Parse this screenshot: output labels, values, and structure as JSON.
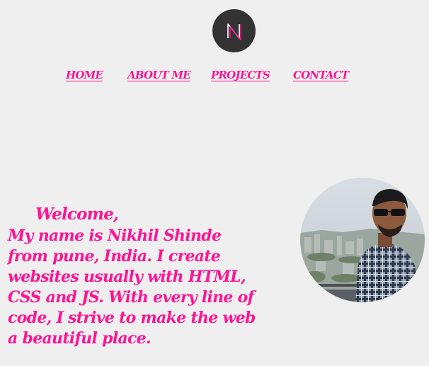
{
  "logo": {
    "letter": "N",
    "icon": "monogram-n-logo",
    "background": "#333333",
    "stroke": "#ffffff"
  },
  "nav": {
    "home": "HOME",
    "about": "ABOUT ME",
    "projects": "PROJECTS",
    "contact": "CONTACT",
    "color": "#ff1493"
  },
  "intro": {
    "welcome": "Welcome,",
    "bio": "My name is Nikhil Shinde from pune, India. I create websites usually with HTML, CSS and JS. With every line of code, I strive to make the web a beautiful place.",
    "color": "#ff1493"
  },
  "profile": {
    "photo": "profile-photo",
    "shape": "circle"
  },
  "page": {
    "background": "#efefef"
  }
}
